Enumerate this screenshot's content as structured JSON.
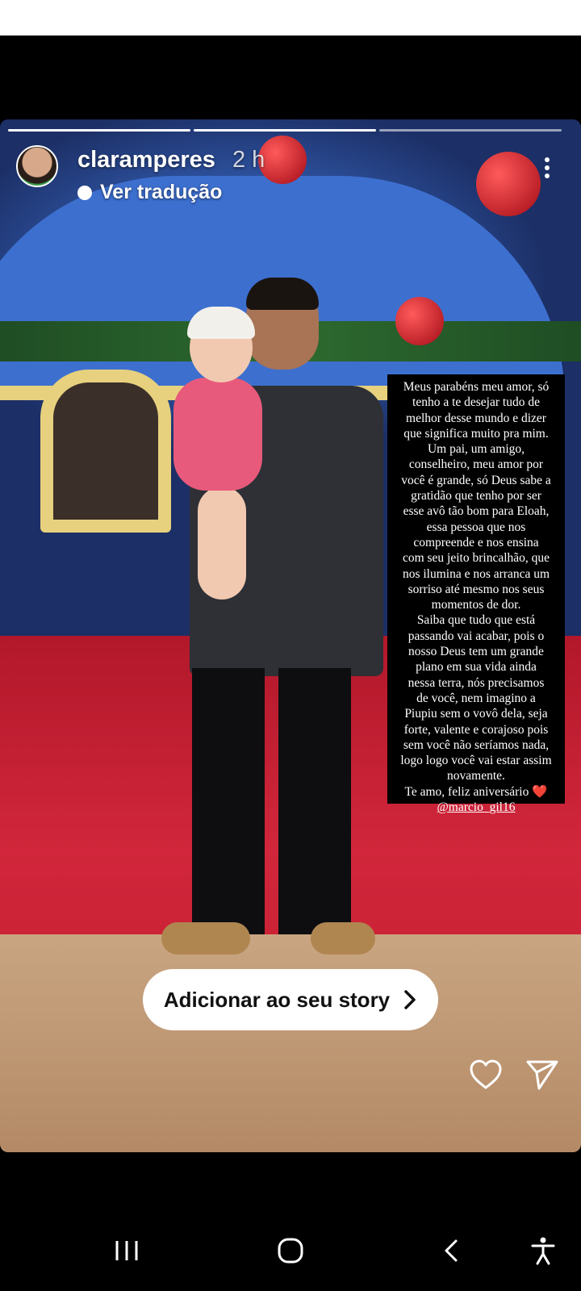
{
  "story": {
    "username": "claramperes",
    "timestamp": "2 h",
    "translate_label": "Ver tradução",
    "progress": {
      "segments": 3,
      "completed": 2
    },
    "caption_lines": "Meus parabéns meu amor, só\ntenho a te desejar tudo de\nmelhor desse mundo e dizer\nque significa muito pra mim.\nUm pai, um amigo,\nconselheiro, meu amor por\nvocê é grande, só Deus sabe a\ngratidão que tenho por ser\nesse avô tão bom para Eloah,\nessa pessoa que nos\ncompreende e nos ensina\ncom seu jeito brincalhão, que\nnos ilumina e nos arranca um\nsorriso até mesmo nos seus\nmomentos de dor.\nSaiba que tudo que está\npassando vai acabar, pois o\nnosso Deus tem um grande\nplano em sua vida ainda\nnessa terra, nós precisamos\nde você, nem imagino a\nPiupiu sem o vovô dela, seja\nforte, valente e corajoso pois\nsem você não seríamos nada,\nlogo logo você vai estar assim\nnovamente.\nTe amo, feliz aniversário ❤️",
    "caption_mention": "@marcio_gil16"
  },
  "cta": {
    "label": "Adicionar ao seu story"
  },
  "icons": {
    "more": "more-vertical-icon",
    "like": "heart-icon",
    "share": "send-icon",
    "cta_arrow": "chevron-right-icon"
  },
  "nav": {
    "recents": "recents-icon",
    "home": "home-icon",
    "back": "back-icon",
    "accessibility": "accessibility-icon"
  },
  "colors": {
    "caption_bg": "#000000",
    "cta_bg": "#ffffff",
    "nav_bg": "#000000"
  }
}
